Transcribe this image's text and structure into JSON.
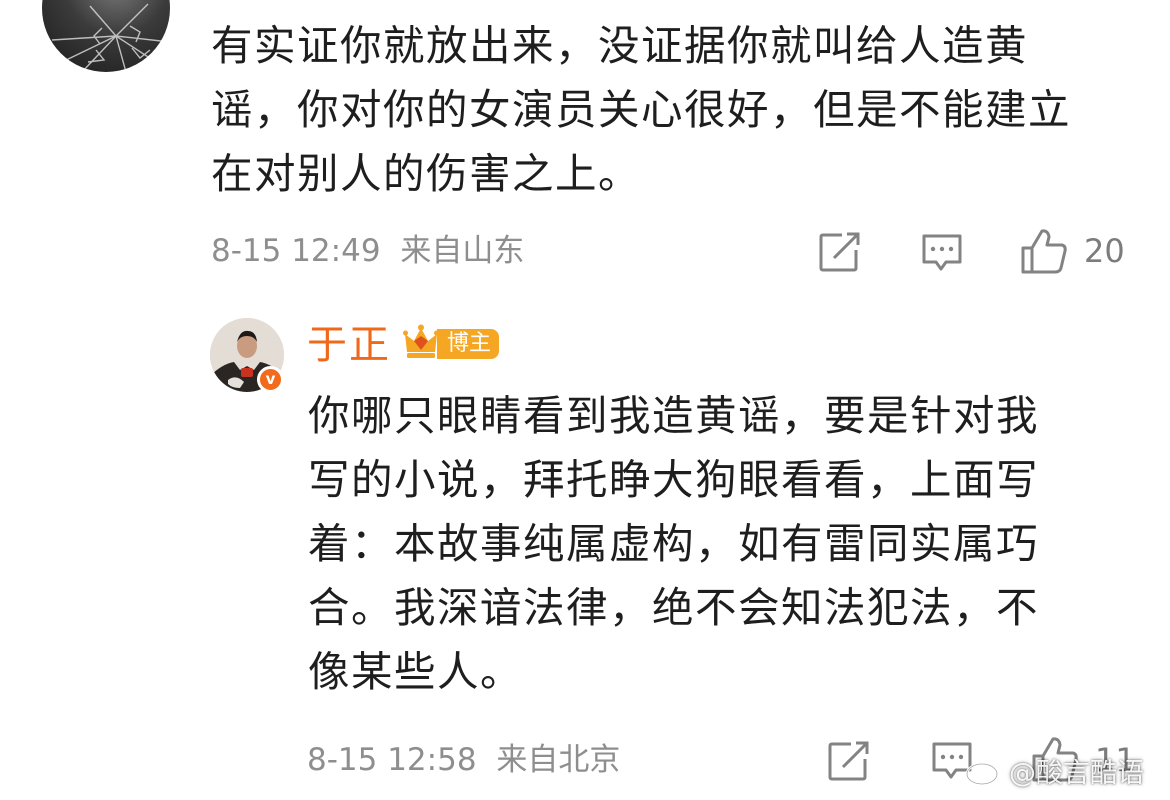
{
  "first_comment": {
    "lines": [
      "有实证你就放出来，没证据你就叫给人造黄",
      "谣，你对你的女演员关心很好，但是不能建立",
      "在对别人的伤害之上。"
    ],
    "date": "8-15 12:49",
    "location": "来自山东",
    "like_count": "20"
  },
  "reply": {
    "author": "于正",
    "author_tag": "博主",
    "verified_mark": "v",
    "lines": [
      "你哪只眼睛看到我造黄谣，要是针对我",
      "写的小说，拜托睁大狗眼看看，上面写",
      "着：本故事纯属虚构，如有雷同实属巧",
      "合。我深谙法律，绝不会知法犯法，不",
      "像某些人。"
    ],
    "date": "8-15 12:58",
    "location": "来自北京",
    "like_count": "11"
  },
  "watermark": {
    "text": "@酸言酷语"
  },
  "icons": {
    "share": "share-icon",
    "comment": "comment-icon",
    "like": "like-icon",
    "crown": "crown-badge-icon",
    "weibo": "weibo-logo-icon"
  },
  "colors": {
    "author_name": "#f0691b",
    "host_tag": "#f5a623",
    "meta_text": "#8e8e8e",
    "body_text": "#1e1e1e"
  }
}
